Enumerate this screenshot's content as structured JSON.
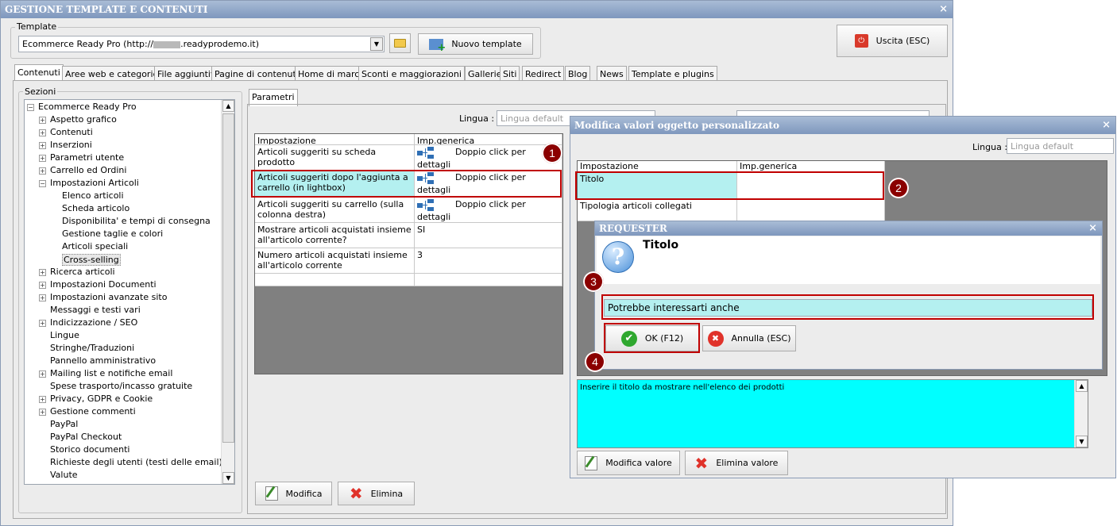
{
  "main_window": {
    "title": "GESTIONE TEMPLATE E CONTENUTI",
    "close": "×"
  },
  "template": {
    "group_label": "Template",
    "selected": "Ecommerce Ready Pro (http://",
    "selected_suffix": ".readyprodemo.it)",
    "new_button": "Nuovo template",
    "exit_button": "Uscita (ESC)"
  },
  "tabs": [
    "Contenuti",
    "Aree web e categorie",
    "File aggiuntivi",
    "Pagine di contenuti",
    "Home di marca",
    "Sconti e maggiorazioni",
    "Gallerie",
    "Siti",
    "Redirect",
    "Blog",
    "News",
    "Template e plugins"
  ],
  "sections": {
    "label": "Sezioni",
    "root": "Ecommerce Ready Pro",
    "items": [
      "Aspetto grafico",
      "Contenuti",
      "Inserzioni",
      "Parametri utente",
      "Carrello ed Ordini",
      "Impostazioni Articoli",
      "Elenco articoli",
      "Scheda articolo",
      "Disponibilita' e tempi di consegna",
      "Gestione taglie e colori",
      "Articoli speciali",
      "Cross-selling",
      "Ricerca articoli",
      "Impostazioni Documenti",
      "Impostazioni avanzate sito",
      "Messaggi e testi vari",
      "Indicizzazione / SEO",
      "Lingue",
      "Stringhe/Traduzioni",
      "Pannello amministrativo",
      "Mailing list e notifiche email",
      "Spese trasporto/incasso gratuite",
      "Privacy, GDPR e Cookie",
      "Gestione commenti",
      "PayPal",
      "PayPal Checkout",
      "Storico documenti",
      "Richieste degli utenti (testi delle email)",
      "Valute"
    ]
  },
  "params": {
    "tab": "Parametri",
    "lingua_label": "Lingua :",
    "lingua_placeholder": "Lingua default",
    "col1": "Impostazione",
    "col2": "Imp.generica",
    "rows": [
      {
        "name": "Articoli suggeriti su scheda prodotto",
        "value": "Doppio click per dettagli"
      },
      {
        "name": "Articoli suggeriti dopo l'aggiunta a carrello (in lightbox)",
        "value": "Doppio click per dettagli"
      },
      {
        "name": "Articoli suggeriti su carrello (sulla colonna destra)",
        "value": "Doppio click per dettagli"
      },
      {
        "name": "Mostrare articoli acquistati insieme all'articolo corrente?",
        "value": "SI"
      },
      {
        "name": "Numero articoli acquistati insieme all'articolo corrente",
        "value": "3"
      }
    ],
    "edit_button": "Modifica",
    "delete_button": "Elimina"
  },
  "custom_dialog": {
    "title": "Modifica valori oggetto personalizzato",
    "close": "×",
    "lingua_label": "Lingua :",
    "lingua_placeholder": "Lingua default",
    "col1": "Impostazione",
    "col2": "Imp.generica",
    "rows": [
      "Titolo",
      "Tipologia articoli collegati"
    ],
    "description": "Inserire il titolo da mostrare nell'elenco dei prodotti",
    "edit_button": "Modifica valore",
    "delete_button": "Elimina valore"
  },
  "requester": {
    "title": "REQUESTER",
    "close": "×",
    "heading": "Titolo",
    "value": "Potrebbe interessarti anche",
    "ok": "OK (F12)",
    "cancel": "Annulla (ESC)"
  },
  "markers": [
    "1",
    "2",
    "3",
    "4"
  ],
  "colors": {
    "title_gradient_top": "#a9bcd6",
    "highlight": "#b4f0f0",
    "description_bg": "#00ffff",
    "marker": "#8b0000",
    "callout": "#c00000"
  }
}
